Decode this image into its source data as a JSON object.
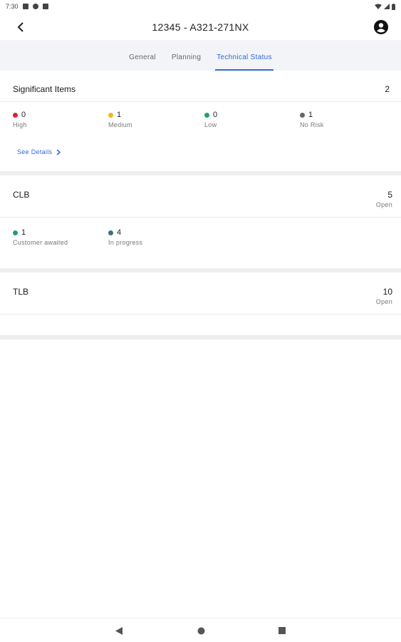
{
  "status_bar": {
    "time": "7:30"
  },
  "header": {
    "title": "12345 - A321-271NX"
  },
  "tabs": [
    {
      "label": "General"
    },
    {
      "label": "Planning"
    },
    {
      "label": "Technical Status"
    }
  ],
  "significant": {
    "title": "Significant Items",
    "count": "2",
    "stats": [
      {
        "value": "0",
        "label": "High",
        "color": "#d7262f"
      },
      {
        "value": "1",
        "label": "Medium",
        "color": "#f3b51b"
      },
      {
        "value": "0",
        "label": "Low",
        "color": "#1fa365"
      },
      {
        "value": "1",
        "label": "No Risk",
        "color": "#666666"
      }
    ],
    "see_details": "See Details"
  },
  "clb": {
    "title": "CLB",
    "count": "5",
    "count_label": "Open",
    "stats": [
      {
        "value": "1",
        "label": "Customer awaited",
        "color": "#1fa365"
      },
      {
        "value": "4",
        "label": "In progress",
        "color": "#3f6f78"
      }
    ]
  },
  "tlb": {
    "title": "TLB",
    "count": "10",
    "count_label": "Open"
  },
  "colors": {
    "accent": "#2f6bd8"
  }
}
